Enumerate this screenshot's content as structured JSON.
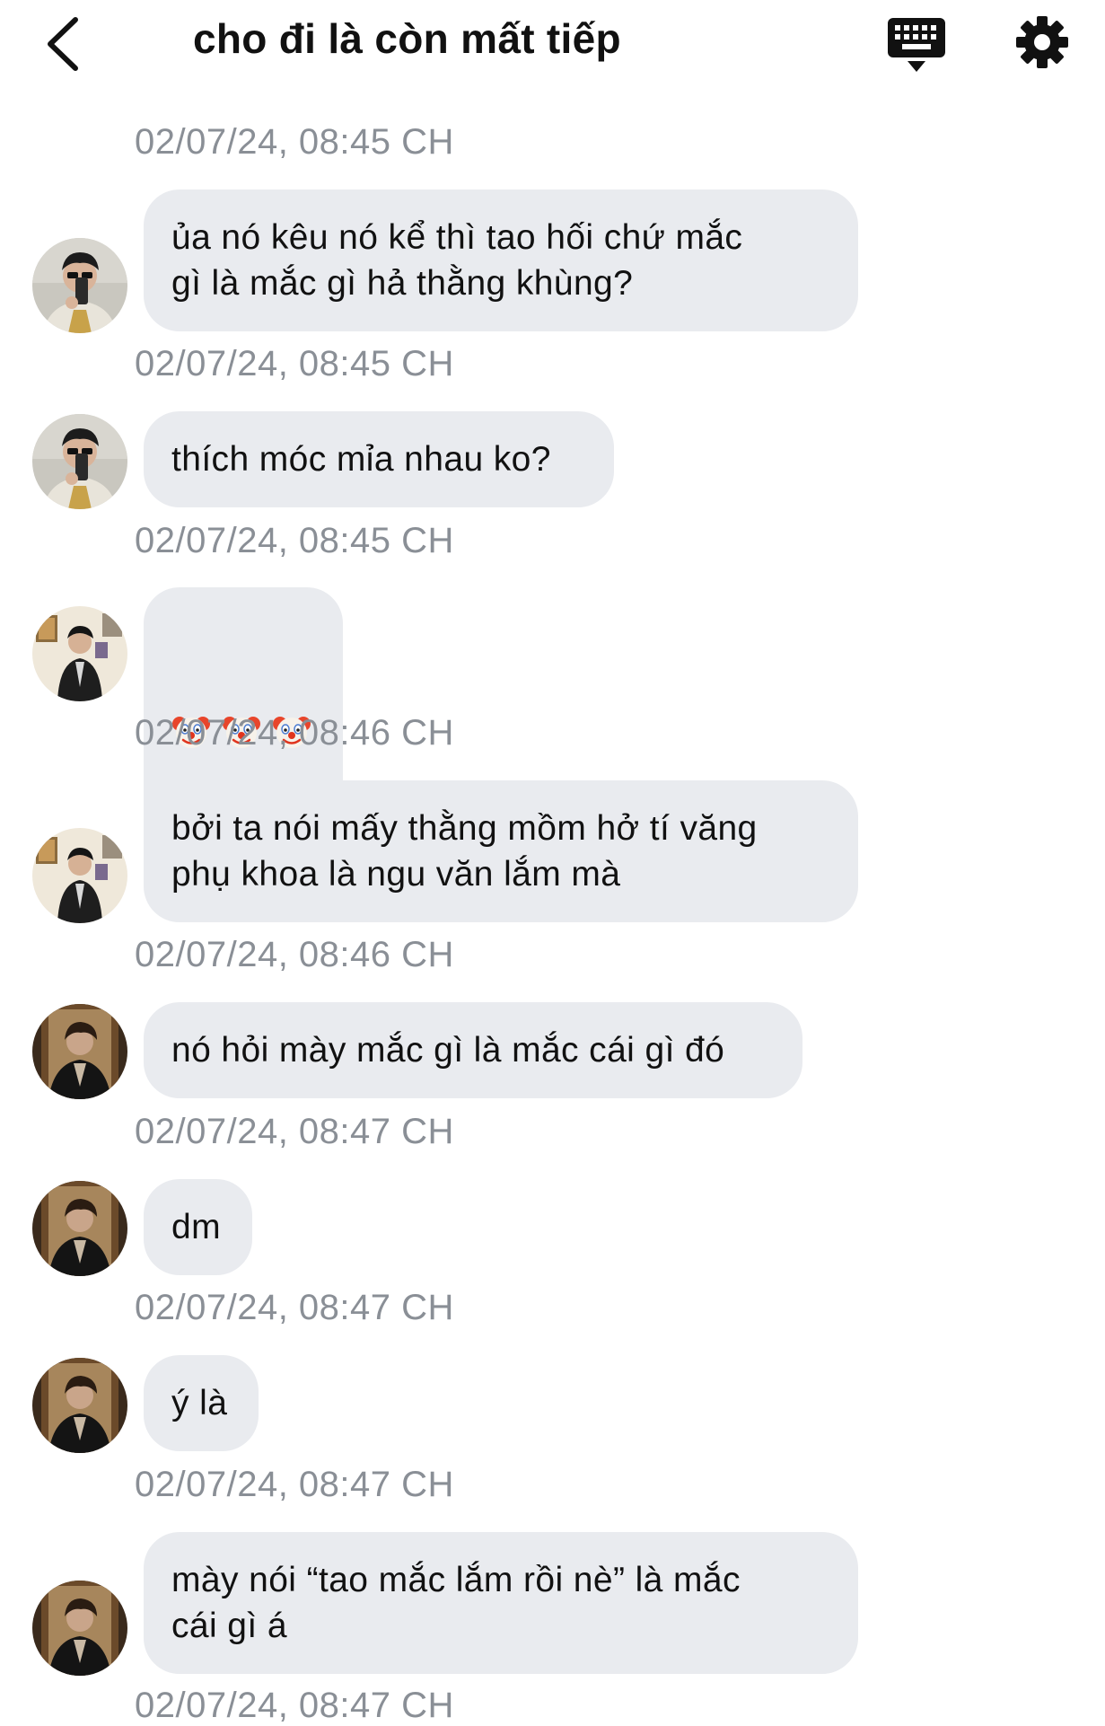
{
  "header": {
    "title": "cho đi là còn mất tiếp"
  },
  "messages": [
    {
      "timestamp": "02/07/24, 08:45 CH",
      "text": "ủa nó kêu nó kể thì tao hối chứ mắc\ngì là mắc gì hả thằng khùng?",
      "avatar": "avatar-sunglasses"
    },
    {
      "timestamp": "02/07/24, 08:45 CH",
      "text": "thích móc mỉa nhau ko?",
      "avatar": "avatar-sunglasses"
    },
    {
      "timestamp": "02/07/24, 08:45 CH",
      "emoji": [
        "clown-face",
        "clown-face",
        "clown-face"
      ],
      "avatar": "avatar-jacket"
    },
    {
      "timestamp": "02/07/24, 08:46 CH",
      "text": "bởi ta nói mấy thằng mồm hở tí văng\nphụ khoa là ngu văn lắm mà",
      "avatar": "avatar-jacket"
    },
    {
      "timestamp": "02/07/24, 08:46 CH",
      "text": "nó hỏi mày mắc gì là mắc cái gì đó",
      "avatar": "avatar-dark"
    },
    {
      "timestamp": "02/07/24, 08:47 CH",
      "text": "dm",
      "avatar": "avatar-dark"
    },
    {
      "timestamp": "02/07/24, 08:47 CH",
      "text": "ý là",
      "avatar": "avatar-dark"
    },
    {
      "timestamp": "02/07/24, 08:47 CH",
      "text": "mày nói “tao mắc lắm rồi nè” là mắc\ncái gì á",
      "avatar": "avatar-dark"
    }
  ],
  "trailing_timestamp": "02/07/24, 08:47 CH",
  "colors": {
    "bubble": "#e9ebef",
    "timestamp": "#8a8f96",
    "text": "#111111"
  }
}
